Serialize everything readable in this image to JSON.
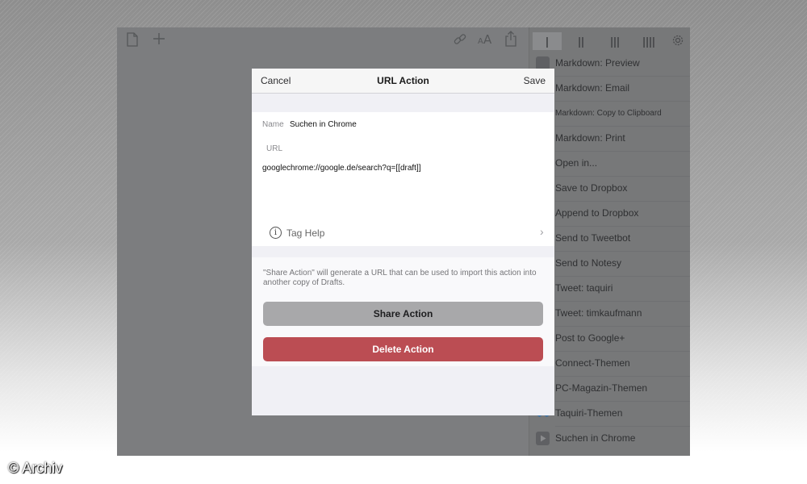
{
  "modal": {
    "cancel_label": "Cancel",
    "title": "URL Action",
    "save_label": "Save",
    "name_label": "Name",
    "name_value": "Suchen in Chrome",
    "url_label": "URL",
    "url_value": "googlechrome://google.de/search?q=[[draft]]",
    "tag_help_label": "Tag Help",
    "share_description": "\"Share Action\" will generate a URL that can be used to import this action into another copy of Drafts.",
    "share_button_label": "Share Action",
    "delete_button_label": "Delete Action"
  },
  "sidebar": {
    "tabs": [
      "|",
      "||",
      "|||",
      "||||"
    ],
    "items": [
      {
        "label": "Markdown: Preview"
      },
      {
        "label": "Markdown: Email"
      },
      {
        "label": "Markdown: Copy to Clipboard"
      },
      {
        "label": "Markdown: Print"
      },
      {
        "label": "Open in..."
      },
      {
        "label": "Save to Dropbox"
      },
      {
        "label": "Append to Dropbox"
      },
      {
        "label": "Send to Tweetbot"
      },
      {
        "label": "Send to Notesy"
      },
      {
        "label": "Tweet: taquiri"
      },
      {
        "label": "Tweet: timkaufmann"
      },
      {
        "label": "Post to Google+"
      },
      {
        "label": "Connect-Themen"
      },
      {
        "label": "PC-Magazin-Themen"
      },
      {
        "label": "Taquiri-Themen"
      },
      {
        "label": "Suchen in Chrome"
      }
    ]
  },
  "toolbar_icons": [
    "document-icon",
    "plus-icon",
    "link-icon",
    "text-size-icon",
    "share-icon",
    "gear-icon"
  ],
  "colors": {
    "delete_red": "#bb4d53",
    "share_gray": "#a8a8aa"
  },
  "watermark": "© Archiv"
}
